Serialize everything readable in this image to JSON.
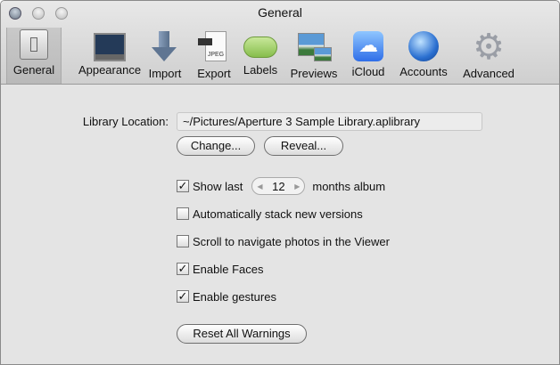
{
  "window": {
    "title": "General"
  },
  "toolbar": {
    "items": [
      {
        "label": "General",
        "icon": "switch-icon"
      },
      {
        "label": "Appearance",
        "icon": "window-icon"
      },
      {
        "label": "Import",
        "icon": "down-arrow-icon"
      },
      {
        "label": "Export",
        "icon": "jpeg-export-icon",
        "icon_text": "JPEG"
      },
      {
        "label": "Labels",
        "icon": "label-pill-icon"
      },
      {
        "label": "Previews",
        "icon": "previews-icon"
      },
      {
        "label": "iCloud",
        "icon": "icloud-icon"
      },
      {
        "label": "Accounts",
        "icon": "globe-icon"
      },
      {
        "label": "Advanced",
        "icon": "gear-icon"
      }
    ]
  },
  "general": {
    "library_label": "Library Location:",
    "library_path": "~/Pictures/Aperture 3 Sample Library.aplibrary",
    "change_button": "Change...",
    "reveal_button": "Reveal...",
    "show_last": {
      "label": "Show last",
      "checked": true,
      "value": "12",
      "suffix": "months album"
    },
    "options": [
      {
        "label": "Automatically stack new versions",
        "checked": false
      },
      {
        "label": "Scroll to navigate photos in the Viewer",
        "checked": false
      },
      {
        "label": "Enable Faces",
        "checked": true
      },
      {
        "label": "Enable gestures",
        "checked": true
      }
    ],
    "reset_button": "Reset All Warnings"
  }
}
